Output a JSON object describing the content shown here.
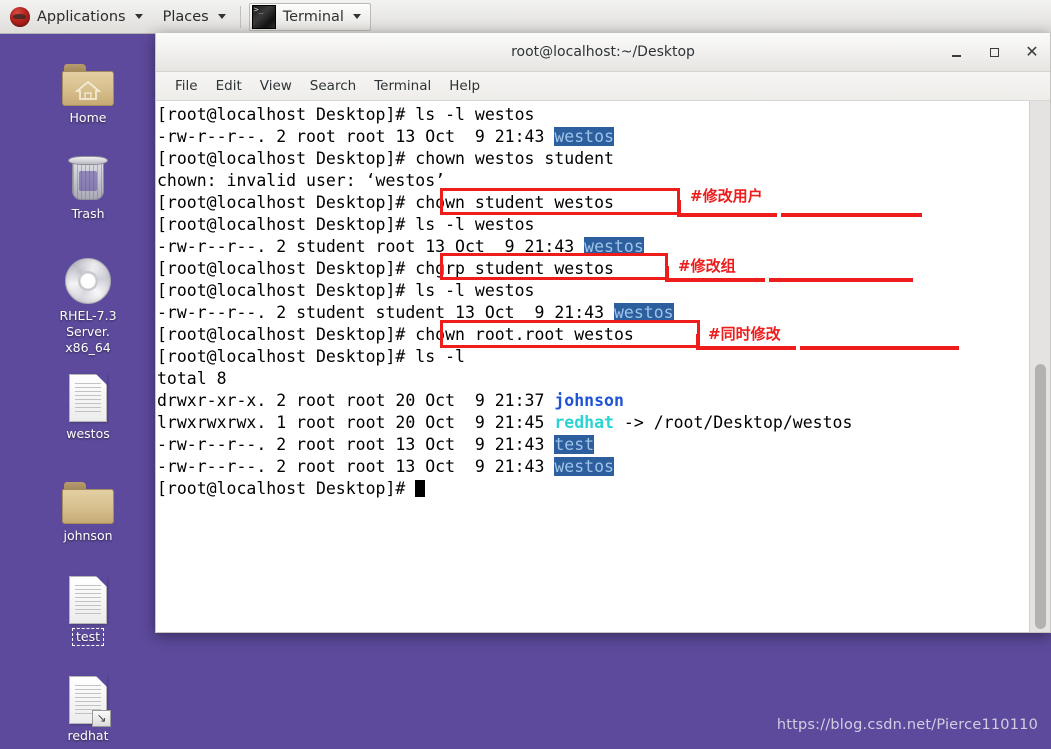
{
  "panel": {
    "applications_label": "Applications",
    "places_label": "Places",
    "task_terminal_label": "Terminal"
  },
  "desktop": {
    "icons": [
      {
        "label": "Home",
        "icon": "folder-home-icon",
        "selected": false
      },
      {
        "label": "Trash",
        "icon": "trash-icon",
        "selected": false
      },
      {
        "label": "RHEL-7.3 Server.\nx86_64",
        "icon": "cd-disc-icon",
        "selected": false
      },
      {
        "label": "westos",
        "icon": "document-icon",
        "selected": false
      },
      {
        "label": "johnson",
        "icon": "folder-icon",
        "selected": false
      },
      {
        "label": "test",
        "icon": "document-icon",
        "selected": true
      },
      {
        "label": "redhat",
        "icon": "document-link-icon",
        "selected": false
      }
    ]
  },
  "window": {
    "title": "root@localhost:~/Desktop",
    "minimize_label": "_",
    "maximize_label": "□",
    "close_label": "✕",
    "menu": [
      "File",
      "Edit",
      "View",
      "Search",
      "Terminal",
      "Help"
    ]
  },
  "terminal": {
    "prompt": "[root@localhost Desktop]# ",
    "lines": [
      {
        "id": 1,
        "segments": [
          {
            "t": "[root@localhost Desktop]# ls -l westos"
          }
        ]
      },
      {
        "id": 2,
        "segments": [
          {
            "t": "-rw-r--r--. 2 root root 13 Oct  9 21:43 "
          },
          {
            "t": "westos",
            "s": "hl"
          }
        ]
      },
      {
        "id": 3,
        "segments": [
          {
            "t": "[root@localhost Desktop]# chown westos student"
          }
        ]
      },
      {
        "id": 4,
        "segments": [
          {
            "t": "chown: invalid user: ‘westos’"
          }
        ]
      },
      {
        "id": 5,
        "segments": [
          {
            "t": "[root@localhost Desktop]# chown student westos"
          }
        ]
      },
      {
        "id": 6,
        "segments": [
          {
            "t": "[root@localhost Desktop]# ls -l westos"
          }
        ]
      },
      {
        "id": 7,
        "segments": [
          {
            "t": "-rw-r--r--. 2 student root 13 Oct  9 21:43 "
          },
          {
            "t": "westos",
            "s": "hl"
          }
        ]
      },
      {
        "id": 8,
        "segments": [
          {
            "t": "[root@localhost Desktop]# chgrp student westos"
          }
        ]
      },
      {
        "id": 9,
        "segments": [
          {
            "t": "[root@localhost Desktop]# ls -l westos"
          }
        ]
      },
      {
        "id": 10,
        "segments": [
          {
            "t": "-rw-r--r--. 2 student student 13 Oct  9 21:43 "
          },
          {
            "t": "westos",
            "s": "hl"
          }
        ]
      },
      {
        "id": 11,
        "segments": [
          {
            "t": "[root@localhost Desktop]# chown root.root westos"
          }
        ]
      },
      {
        "id": 12,
        "segments": [
          {
            "t": "[root@localhost Desktop]# ls -l"
          }
        ]
      },
      {
        "id": 13,
        "segments": [
          {
            "t": "total 8"
          }
        ]
      },
      {
        "id": 14,
        "segments": [
          {
            "t": "drwxr-xr-x. 2 root root 20 Oct  9 21:37 "
          },
          {
            "t": "johnson",
            "s": "c-blue"
          }
        ]
      },
      {
        "id": 15,
        "segments": [
          {
            "t": "lrwxrwxrwx. 1 root root 20 Oct  9 21:45 "
          },
          {
            "t": "redhat",
            "s": "c-cyan"
          },
          {
            "t": " -> /root/Desktop/westos"
          }
        ]
      },
      {
        "id": 16,
        "segments": [
          {
            "t": "-rw-r--r--. 2 root root 13 Oct  9 21:43 "
          },
          {
            "t": "test",
            "s": "hl"
          }
        ]
      },
      {
        "id": 17,
        "segments": [
          {
            "t": "-rw-r--r--. 2 root root 13 Oct  9 21:43 "
          },
          {
            "t": "westos",
            "s": "hl"
          }
        ]
      },
      {
        "id": 18,
        "segments": [
          {
            "t": "[root@localhost Desktop]# "
          },
          {
            "t": "",
            "s": "cursor"
          }
        ]
      }
    ]
  },
  "annotations": [
    {
      "id": "ann-chown-user",
      "label": "#修改用户",
      "boxes_command": "chown student westos"
    },
    {
      "id": "ann-chgrp-group",
      "label": "#修改组",
      "boxes_command": "chgrp student westos"
    },
    {
      "id": "ann-chown-both",
      "label": "#同时修改",
      "boxes_command": "chown root.root westos"
    }
  ],
  "watermark": "https://blog.csdn.net/Pierce110110",
  "colors": {
    "desktop_bg": "#5d4a9c",
    "annotation_red": "#ef1c1c",
    "terminal_highlight_bg": "#2d5f9e",
    "terminal_highlight_fg": "#9fc4ea",
    "dir_blue": "#1f53d6",
    "link_cyan": "#2bd4d4"
  }
}
